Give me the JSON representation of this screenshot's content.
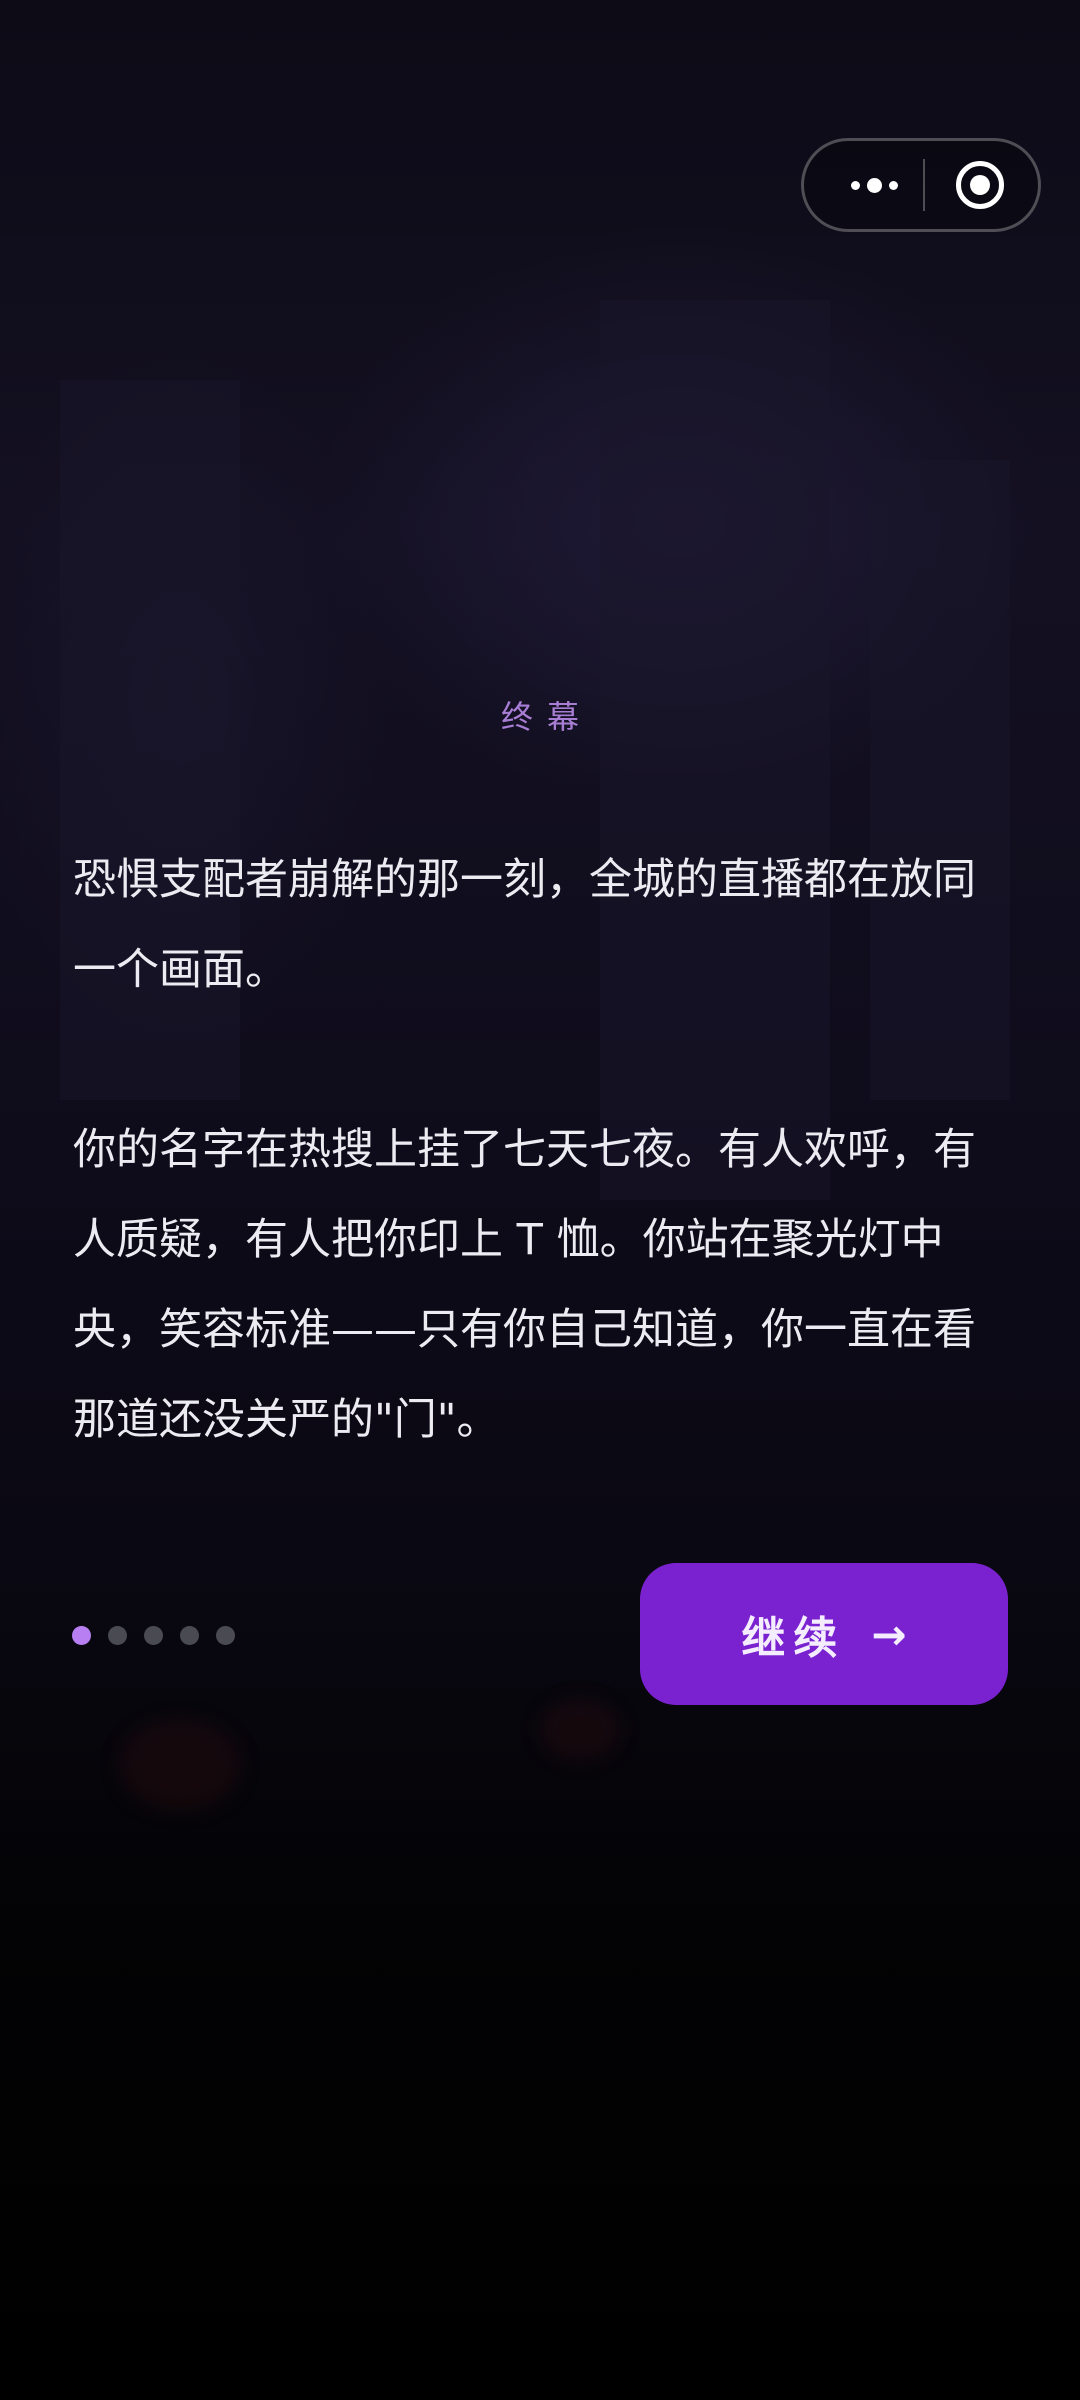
{
  "capsule": {
    "more_icon": "more-dots-icon",
    "close_icon": "target-close-icon"
  },
  "chapter": {
    "title": "终幕"
  },
  "story": {
    "paragraphs": [
      "恐惧支配者崩解的那一刻，全城的直播都在放同一个画面。",
      "你的名字在热搜上挂了七天七夜。有人欢呼，有人质疑，有人把你印上 T 恤。你站在聚光灯中央，笑容标准——只有你自己知道，你一直在看那道还没关严的\"门\"。"
    ]
  },
  "pagination": {
    "total": 5,
    "current": 1
  },
  "actions": {
    "continue_label": "继续",
    "continue_arrow": "→"
  },
  "colors": {
    "accent": "#7b22d0",
    "active_dot": "#b77ff1",
    "inactive_dot": "#4a4a52",
    "chapter_title": "#a77ed3",
    "text": "#ecebf1"
  }
}
